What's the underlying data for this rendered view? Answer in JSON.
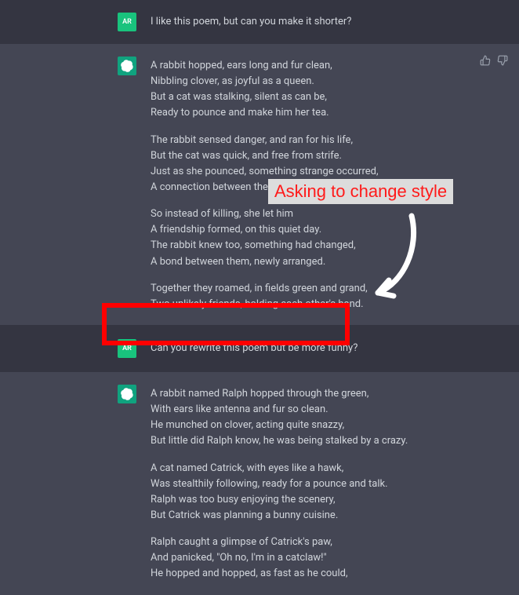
{
  "user_avatar_initials": "AR",
  "messages": {
    "m0": {
      "role": "user",
      "text": "I like this poem, but can you make it shorter?"
    },
    "m1": {
      "role": "assistant",
      "stanzas": [
        "A rabbit hopped, ears long and fur clean,\nNibbling clover, as joyful as a queen.\nBut a cat was stalking, silent as can be,\nReady to pounce and make him her tea.",
        "The rabbit sensed danger, and ran for his life,\nBut the cat was quick, and free from strife.\nJust as she pounced, something strange occurred,\nA connection between them, and the rabbit was spared.",
        "So instead of killing, she let him\nA friendship formed, on this quiet day.\nThe rabbit knew too, something had changed,\nA bond between them, newly arranged.",
        "Together they roamed, in fields green and grand,\nTwo unlikely friends, holding each other's hand."
      ]
    },
    "m2": {
      "role": "user",
      "text": "Can you rewrite this poem but be more funny?"
    },
    "m3": {
      "role": "assistant",
      "stanzas": [
        "A rabbit named Ralph hopped through the green,\nWith ears like antenna and fur so clean.\nHe munched on clover, acting quite snazzy,\nBut little did Ralph know, he was being stalked by a crazy.",
        "A cat named Catrick, with eyes like a hawk,\nWas stealthily following, ready for a pounce and talk.\nRalph was too busy enjoying the scenery,\nBut Catrick was planning a bunny cuisine.",
        "Ralph caught a glimpse of Catrick's paw,\nAnd panicked, \"Oh no, I'm in a catclaw!\"\nHe hopped and hopped, as fast as he could,"
      ]
    }
  },
  "annotation": {
    "label": "Asking to change style"
  }
}
